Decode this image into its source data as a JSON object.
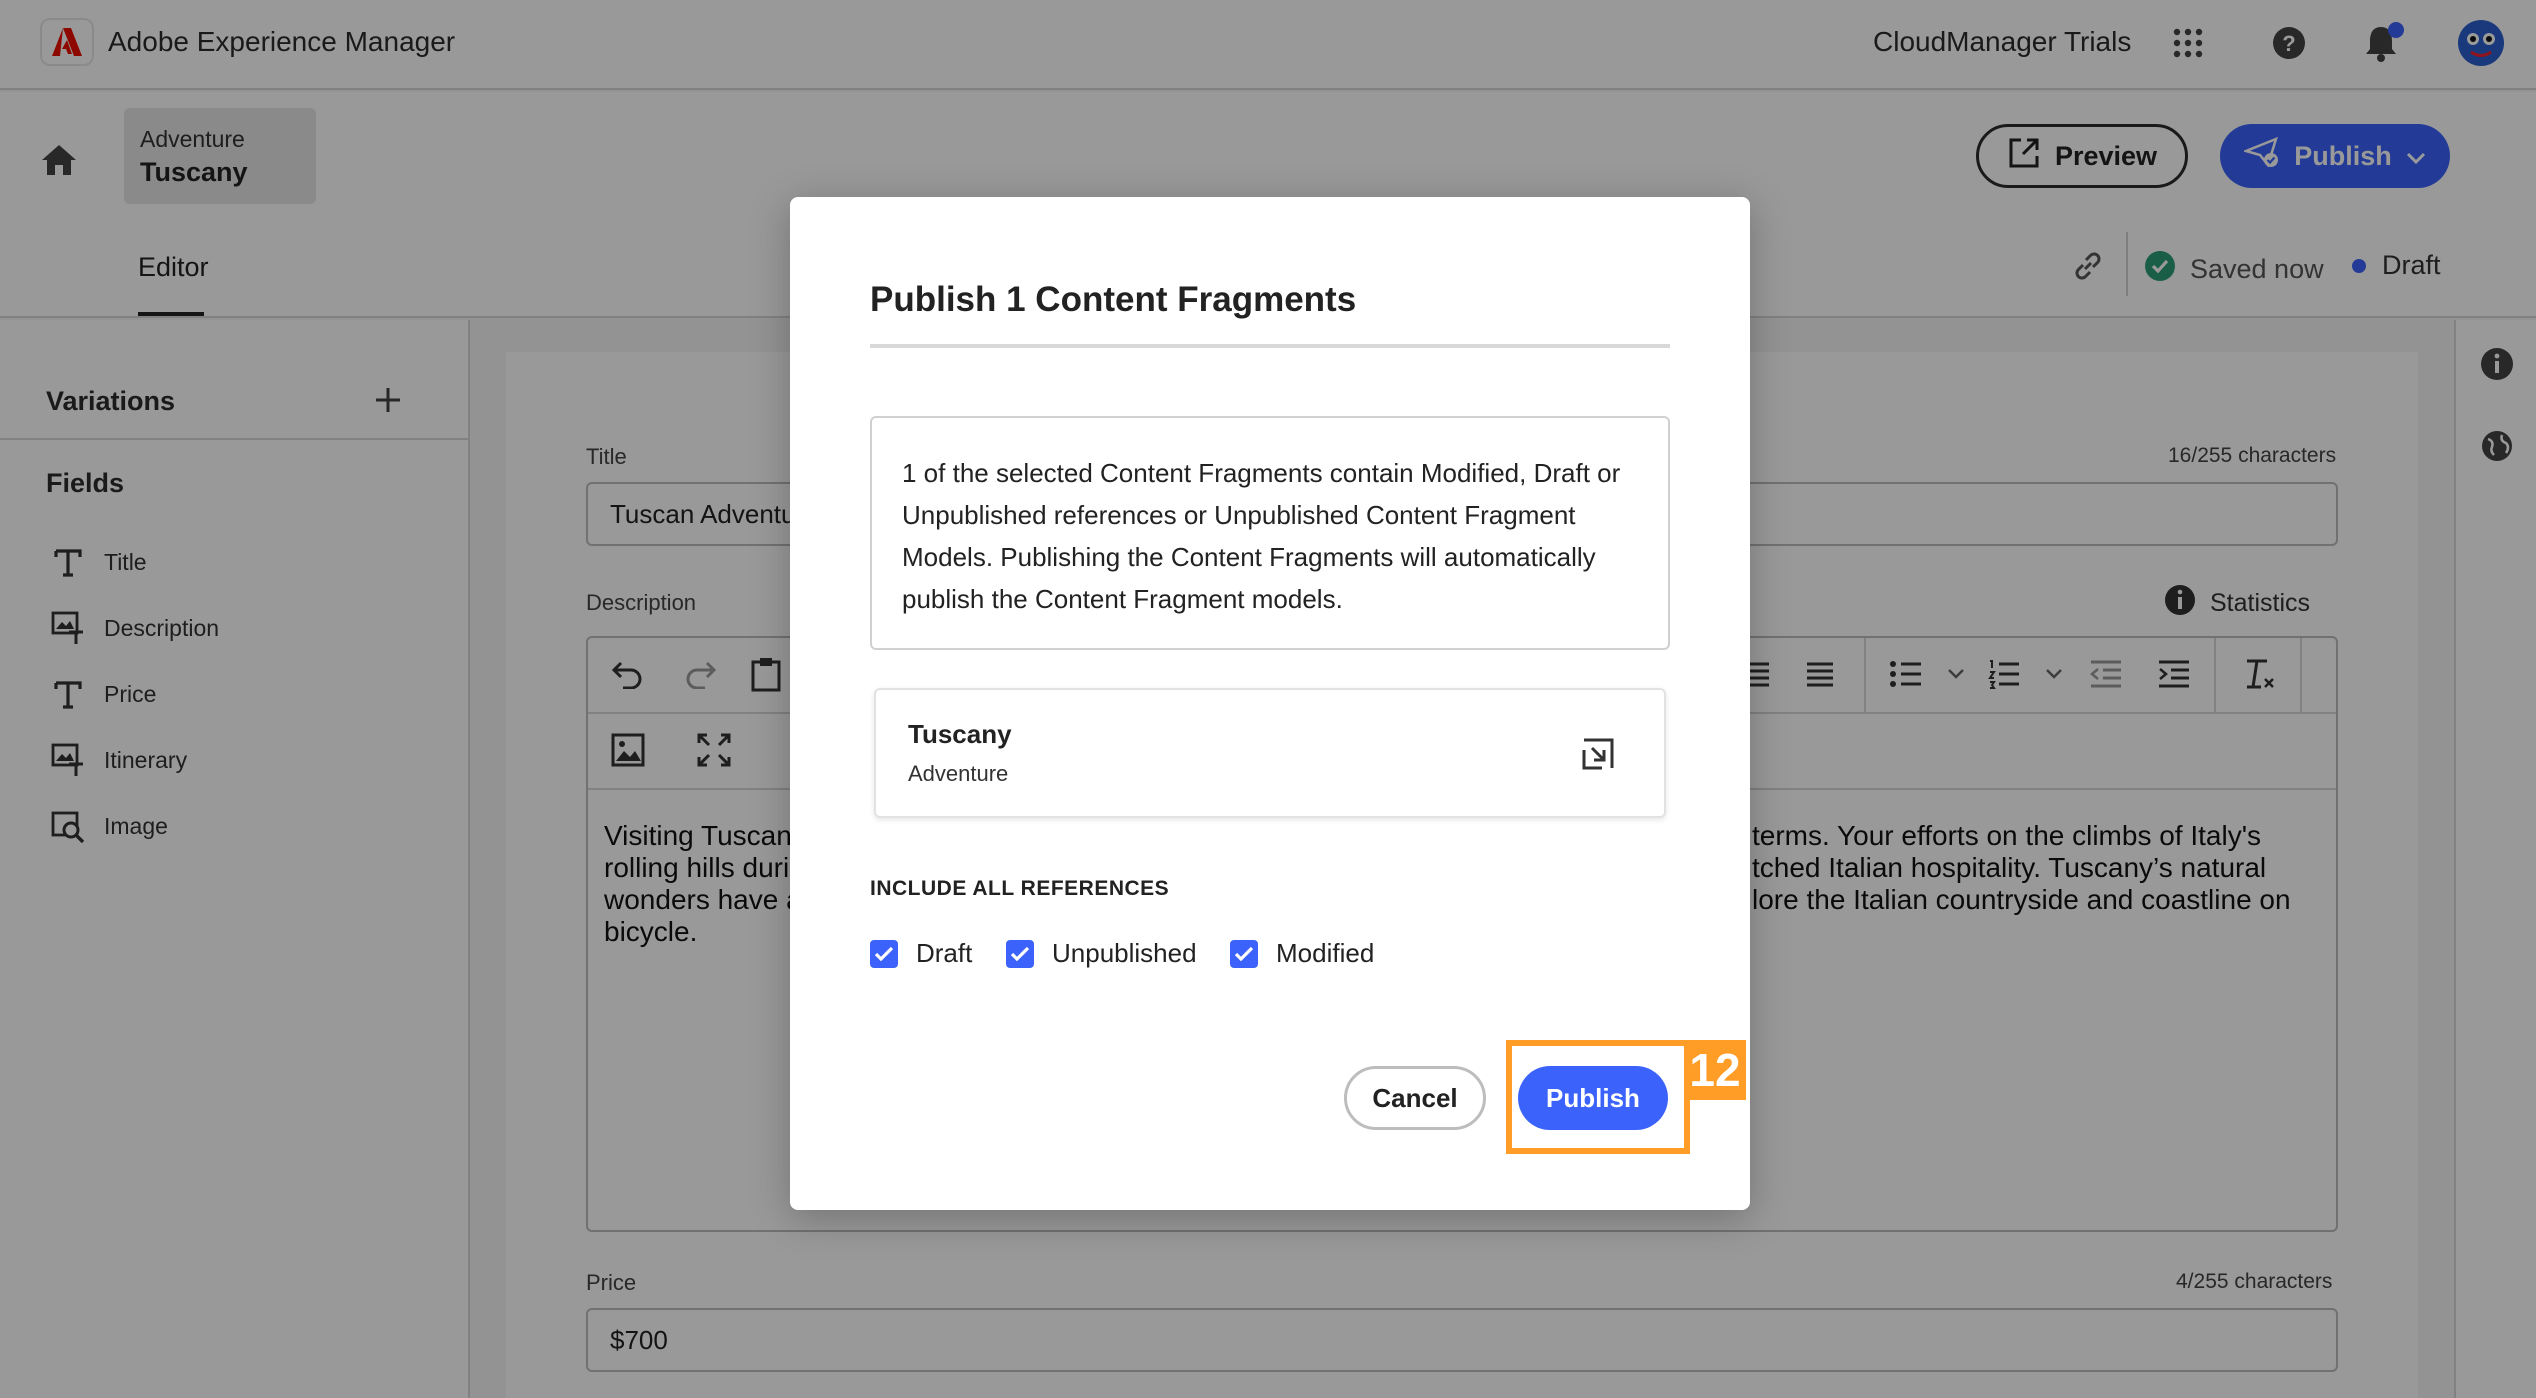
{
  "app": {
    "title": "Adobe Experience Manager",
    "org_name": "CloudManager Trials"
  },
  "breadcrumb": {
    "parent": "Adventure",
    "current": "Tuscany"
  },
  "tabs": [
    {
      "label": "Editor",
      "active": true
    }
  ],
  "header_actions": {
    "preview_label": "Preview",
    "publish_label": "Publish"
  },
  "status": {
    "saved_label": "Saved now",
    "state_label": "Draft"
  },
  "sidebar": {
    "variations_label": "Variations",
    "fields_label": "Fields",
    "fields": [
      {
        "label": "Title",
        "icon": "text-field-icon"
      },
      {
        "label": "Description",
        "icon": "rich-text-icon"
      },
      {
        "label": "Price",
        "icon": "text-field-icon"
      },
      {
        "label": "Itinerary",
        "icon": "rich-text-icon"
      },
      {
        "label": "Image",
        "icon": "image-search-icon"
      }
    ]
  },
  "form": {
    "title_label": "Title",
    "title_count": "16/255 characters",
    "title_value": "Tuscan Adventu",
    "description_label": "Description",
    "statistics_label": "Statistics",
    "description_line1_left": "Visiting Tuscan",
    "description_line2_left": "rolling hills duri",
    "description_line3_left": "wonders have a",
    "description_line4_left": "bicycle.",
    "description_line1_right": "terms. Your efforts on the climbs of Italy's",
    "description_line2_right": "tched Italian hospitality. Tuscany’s natural",
    "description_line3_right": "lore the Italian countryside and coastline on",
    "price_label": "Price",
    "price_count": "4/255 characters",
    "price_value": "$700"
  },
  "dialog": {
    "title": "Publish 1 Content Fragments",
    "message": "1 of the selected Content Fragments contain Modified, Draft or Unpublished references or Unpublished Content Fragment Models. Publishing the Content Fragments will automatically publish the Content Fragment models.",
    "fragment_title": "Tuscany",
    "fragment_model": "Adventure",
    "include_label": "INCLUDE ALL REFERENCES",
    "checkboxes": [
      {
        "label": "Draft",
        "checked": true
      },
      {
        "label": "Unpublished",
        "checked": true
      },
      {
        "label": "Modified",
        "checked": true
      }
    ],
    "cancel_label": "Cancel",
    "publish_label": "Publish"
  },
  "step_marker": "12",
  "colors": {
    "accent": "#3b63fb",
    "highlight": "#ff9d26",
    "success": "#2d9d78",
    "brand": "#eb1000"
  }
}
